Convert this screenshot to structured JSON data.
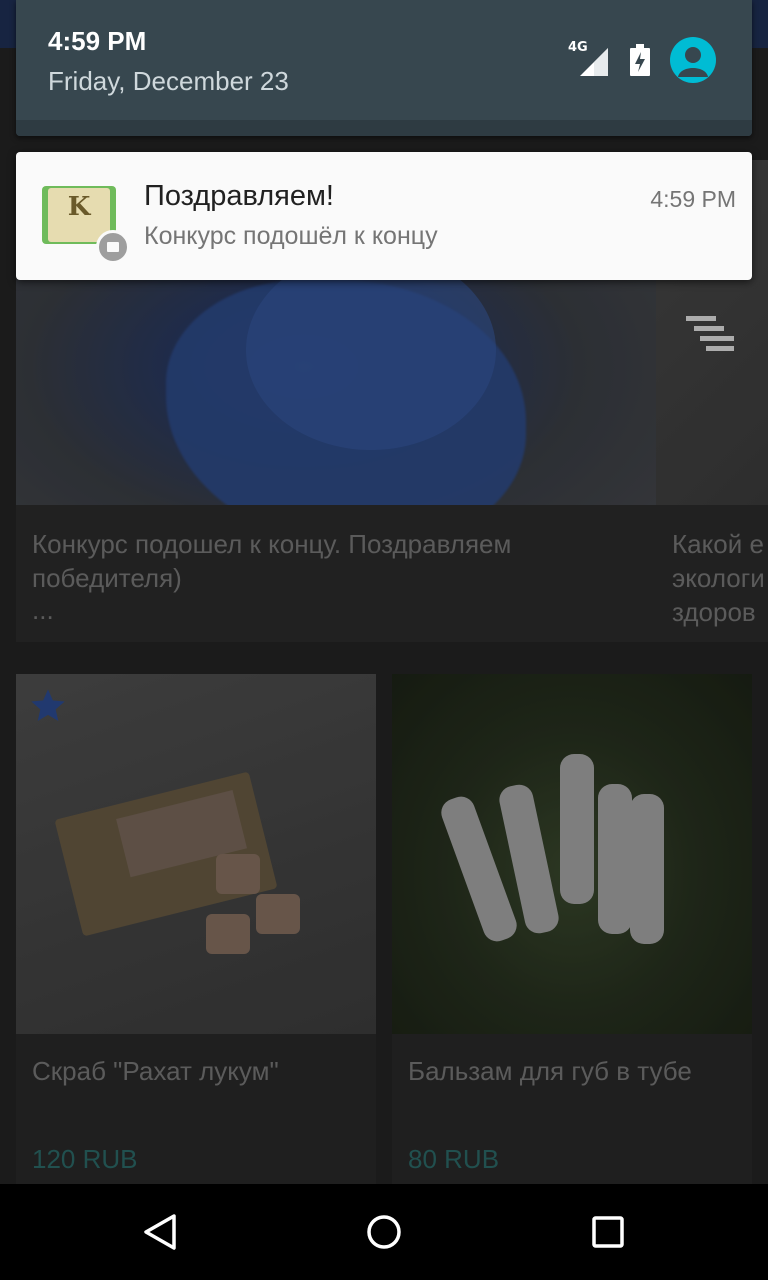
{
  "status": {
    "time": "4:59 PM",
    "date": "Friday, December 23",
    "network": "4G",
    "icons": [
      "signal-icon",
      "battery-icon",
      "user-avatar-icon"
    ],
    "accent_color": "#00bcd4"
  },
  "notification": {
    "app_icon_letter": "K",
    "title": "Поздравляем!",
    "text": "Конкурс подошёл к концу",
    "time": "4:59 PM"
  },
  "background_app": {
    "banner_main_caption_line1": "Конкурс подошел к концу. Поздравляем",
    "banner_main_caption_line2": "победителя)",
    "banner_main_caption_more": "...",
    "banner_side_caption_line1": "Какой е",
    "banner_side_caption_line2": "экологи",
    "banner_side_caption_line3": "здоров",
    "products": [
      {
        "title": "Скраб \"Рахат лукум\"",
        "price": "120 RUB",
        "favorite": true
      },
      {
        "title": "Бальзам для губ в тубе",
        "price": "80 RUB",
        "favorite": false
      }
    ],
    "price_color": "#2c6b6a"
  },
  "navbar": {
    "buttons": [
      "back-icon",
      "home-icon",
      "recent-apps-icon"
    ]
  }
}
